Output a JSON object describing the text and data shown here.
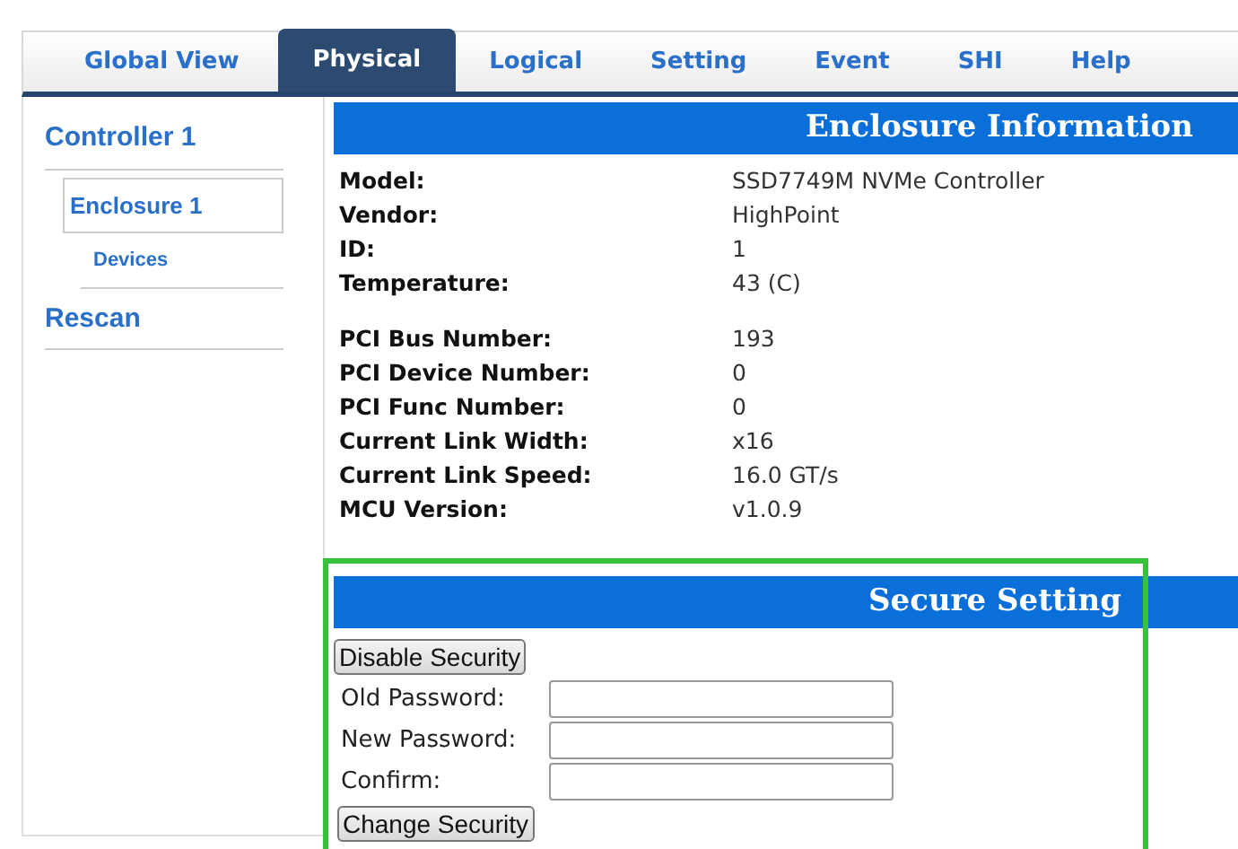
{
  "tabs": [
    {
      "label": "Global View",
      "selected": false
    },
    {
      "label": "Physical",
      "selected": true
    },
    {
      "label": "Logical",
      "selected": false
    },
    {
      "label": "Setting",
      "selected": false
    },
    {
      "label": "Event",
      "selected": false
    },
    {
      "label": "SHI",
      "selected": false
    },
    {
      "label": "Help",
      "selected": false
    }
  ],
  "sidebar": {
    "items": [
      {
        "label": "Controller 1",
        "selected": false,
        "children": [
          {
            "label": "Enclosure 1",
            "selected": true,
            "children": [
              {
                "label": "Devices",
                "selected": false
              }
            ]
          }
        ]
      },
      {
        "label": "Rescan",
        "selected": false
      }
    ]
  },
  "enclosure_information": {
    "title": "Enclosure Information",
    "groups": [
      [
        {
          "label": "Model:",
          "value": "SSD7749M NVMe Controller"
        },
        {
          "label": "Vendor:",
          "value": "HighPoint"
        },
        {
          "label": "ID:",
          "value": "1"
        },
        {
          "label": "Temperature:",
          "value": "43 (C)"
        }
      ],
      [
        {
          "label": "PCI Bus Number:",
          "value": "193"
        },
        {
          "label": "PCI Device Number:",
          "value": "0"
        },
        {
          "label": "PCI Func Number:",
          "value": "0"
        },
        {
          "label": "Current Link Width:",
          "value": "x16"
        },
        {
          "label": "Current Link Speed:",
          "value": "16.0 GT/s"
        },
        {
          "label": "MCU Version:",
          "value": "v1.0.9"
        }
      ]
    ]
  },
  "secure_setting": {
    "title": "Secure Setting",
    "highlighted": true,
    "disable_button": "Disable Security",
    "fields": [
      {
        "label": "Old Password:"
      },
      {
        "label": "New Password:"
      },
      {
        "label": "Confirm:"
      }
    ],
    "change_button": "Change Security"
  }
}
